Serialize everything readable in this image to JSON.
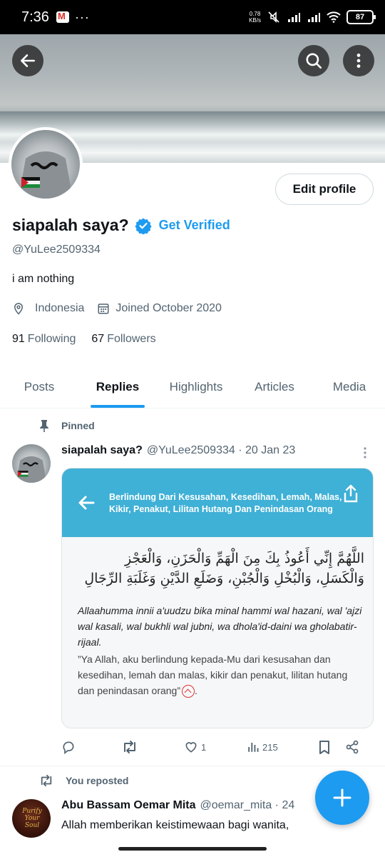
{
  "status_bar": {
    "time": "7:36",
    "speed_value": "0.78",
    "speed_unit": "KB/s",
    "battery": "87",
    "more": "···"
  },
  "profile": {
    "display_name": "siapalah saya?",
    "get_verified": "Get Verified",
    "handle": "@YuLee2509334",
    "bio": "i am nothing",
    "location": "Indonesia",
    "joined": "Joined October 2020",
    "following_count": "91",
    "following_label": "Following",
    "followers_count": "67",
    "followers_label": "Followers",
    "edit_label": "Edit profile"
  },
  "tabs": [
    {
      "label": "Posts",
      "active": false
    },
    {
      "label": "Replies",
      "active": true
    },
    {
      "label": "Highlights",
      "active": false
    },
    {
      "label": "Articles",
      "active": false
    },
    {
      "label": "Media",
      "active": false
    }
  ],
  "pinned_post": {
    "context": "Pinned",
    "author": "siapalah saya?",
    "meta": "@YuLee2509334 · 20 Jan 23",
    "card": {
      "title": "Berlindung Dari Kesusahan, Kesedihan, Lemah, Malas, Kikir, Penakut, Lilitan Hutang Dan Penindasan Orang",
      "arabic": "اللَّهُمَّ إِنِّي أَعُوذُ بِكَ مِنَ الْهَمِّ وَالْحَزَنِ، وَالْعَجْزِ وَالْكَسَلِ، وَالْبُخْلِ وَالْجُبْنِ، وَضَلَعِ الدَّيْنِ وَغَلَبَةِ الرِّجَالِ",
      "latin": "Allaahumma innii a'uudzu bika minal hammi wal hazani, wal 'ajzi wal kasali, wal bukhli wal jubni, wa dhola'id-daini wa gholabatir-rijaal.",
      "translation": "”Ya Allah, aku berlindung kepada-Mu dari kesusahan dan kesedihan, lemah dan malas, kikir dan penakut, lilitan hutang dan penindasan orang”"
    },
    "likes": "1",
    "views": "215"
  },
  "repost": {
    "context": "You reposted",
    "author": "Abu Bassam Oemar Mita",
    "meta": "@oemar_mita · 24",
    "text": "Allah memberikan keistimewaan bagi wanita,",
    "avatar_text": "Purify Your Soul"
  },
  "colors": {
    "accent": "#1d9bf0",
    "text": "#0f1419",
    "muted": "#536471",
    "card_header": "#3fb0d6"
  }
}
